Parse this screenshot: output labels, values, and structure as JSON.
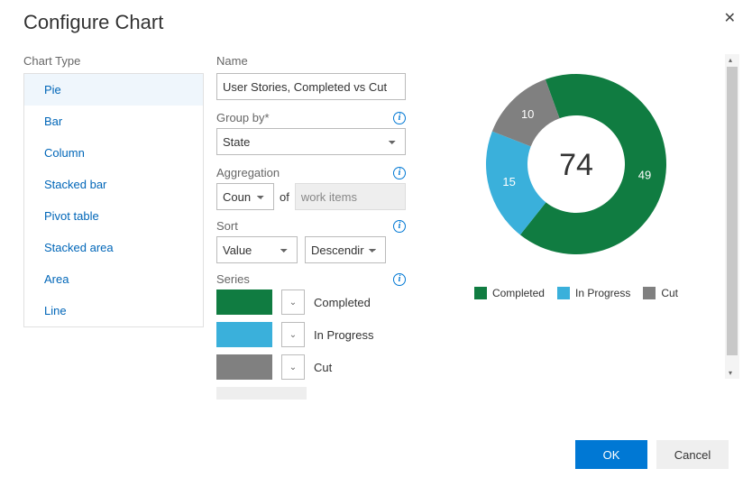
{
  "dialog": {
    "title": "Configure Chart"
  },
  "chart_type": {
    "label": "Chart Type",
    "items": [
      "Pie",
      "Bar",
      "Column",
      "Stacked bar",
      "Pivot table",
      "Stacked area",
      "Area",
      "Line"
    ],
    "selected_index": 0
  },
  "config": {
    "name": {
      "label": "Name",
      "value": "User Stories, Completed vs Cut"
    },
    "group_by": {
      "label": "Group by*",
      "value": "State"
    },
    "aggregation": {
      "label": "Aggregation",
      "func": "Coun",
      "of_label": "of",
      "of_value": "work items"
    },
    "sort": {
      "label": "Sort",
      "field": "Value",
      "direction": "Descendir"
    },
    "series": {
      "label": "Series",
      "items": [
        {
          "label": "Completed",
          "color": "#107c41"
        },
        {
          "label": "In Progress",
          "color": "#3ab0db"
        },
        {
          "label": "Cut",
          "color": "#808080"
        }
      ]
    }
  },
  "chart_data": {
    "type": "pie",
    "title": "",
    "total": 74,
    "series": [
      {
        "name": "Completed",
        "value": 49,
        "color": "#107c41"
      },
      {
        "name": "In Progress",
        "value": 15,
        "color": "#3ab0db"
      },
      {
        "name": "Cut",
        "value": 10,
        "color": "#808080"
      }
    ]
  },
  "buttons": {
    "ok": "OK",
    "cancel": "Cancel"
  }
}
